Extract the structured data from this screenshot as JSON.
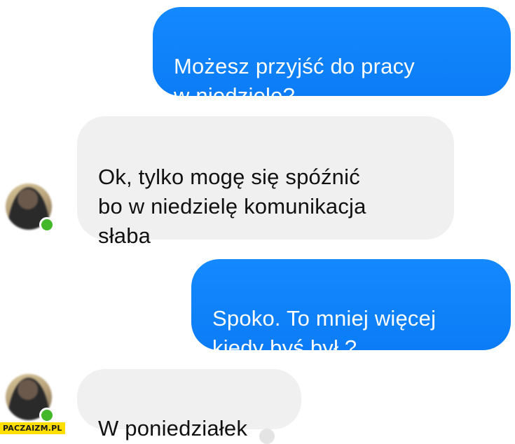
{
  "conversation": {
    "messages": [
      {
        "direction": "outgoing",
        "text": "Możesz przyjść do pracy\nw niedzielę?"
      },
      {
        "direction": "incoming",
        "text": "Ok, tylko mogę się spóźnić\nbo w niedzielę komunikacja\nsłaba"
      },
      {
        "direction": "outgoing",
        "text": "Spoko. To mniej więcej\nkiedy byś był ?"
      },
      {
        "direction": "incoming",
        "text": "W poniedziałek"
      }
    ]
  },
  "contact": {
    "online_status_color": "#42b72a"
  },
  "colors": {
    "outgoing_bubble": "#0b7cf5",
    "incoming_bubble": "#f1f0f0"
  },
  "watermark": {
    "text": "PACZAIZM.PL",
    "color": "#ffde00"
  }
}
